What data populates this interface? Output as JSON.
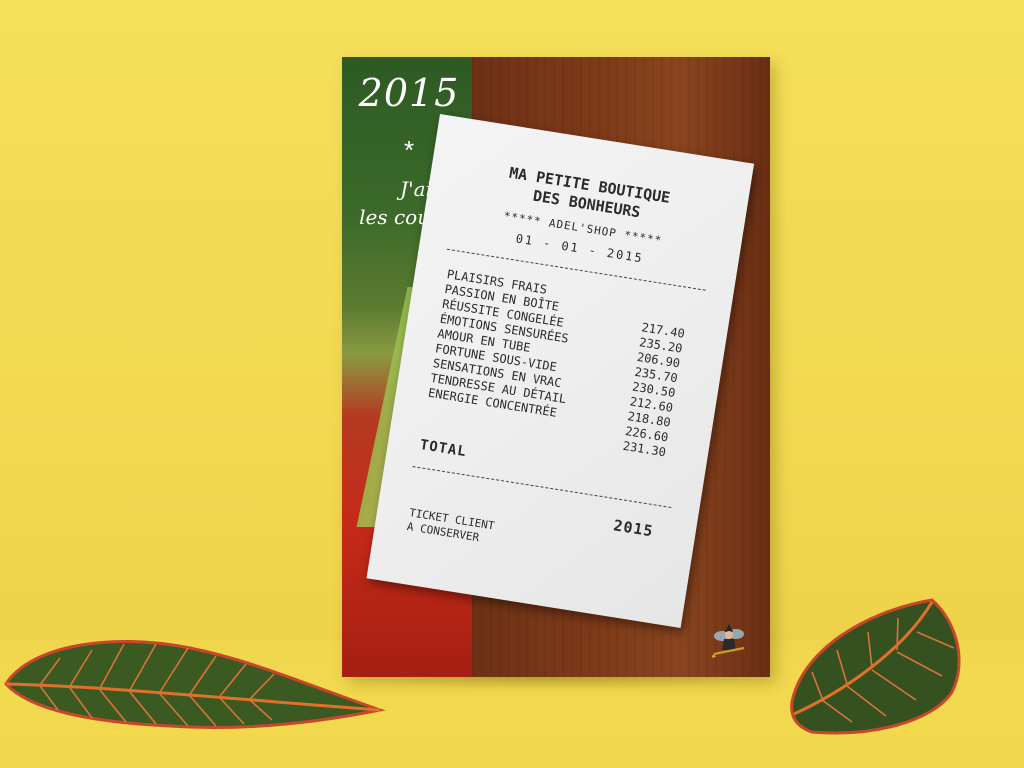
{
  "poster": {
    "year": "2015",
    "star": "*",
    "slogan_line1": "J'ai fait",
    "slogan_line2": "les courses !"
  },
  "receipt": {
    "shop_line1": "MA PETITE BOUTIQUE",
    "shop_line2": "DES BONHEURS",
    "shop_sub": "***** ADEL'SHOP *****",
    "date": "01 - 01 - 2015",
    "items": [
      "PLAISIRS FRAIS",
      "PASSION EN BOÎTE",
      "RÉUSSITE CONGELÉE",
      "ÉMOTIONS SENSURÉES",
      "AMOUR EN TUBE",
      "FORTUNE SOUS-VIDE",
      "SENSATIONS EN VRAC",
      "TENDRESSE AU DÉTAIL",
      "ENERGIE CONCENTRÉE"
    ],
    "prices": [
      "217.40",
      "235.20",
      "206.90",
      "235.70",
      "230.50",
      "212.60",
      "218.80",
      "226.60",
      "231.30"
    ],
    "total_label": "TOTAL",
    "total_value": "2015",
    "footer_line1": "TICKET CLIENT",
    "footer_line2": "A CONSERVER"
  },
  "colors": {
    "background": "#f3dc55",
    "poster_wood": "#7d3a19",
    "poster_green": "#2d5a23",
    "poster_red": "#c62a18",
    "receipt_paper": "#eeeeee"
  }
}
